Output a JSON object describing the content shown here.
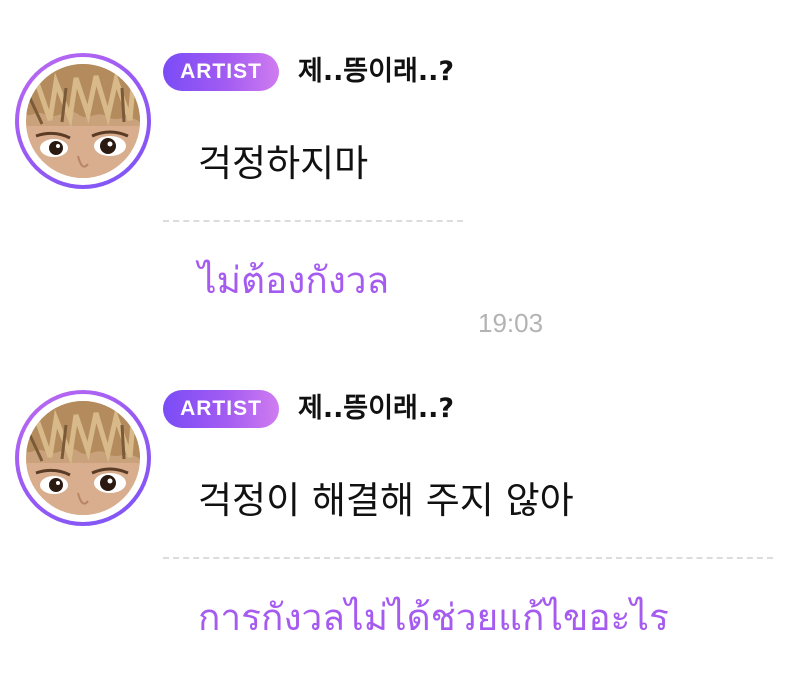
{
  "messages": [
    {
      "badge": "ARTIST",
      "sender": "제..뜽이래..?",
      "original_text": "걱정하지마",
      "translated_text": "ไม่ต้องกังวล",
      "timestamp": "19:03"
    },
    {
      "badge": "ARTIST",
      "sender": "제..뜽이래..?",
      "original_text": "걱정이 해결해 주지 않아",
      "translated_text": "การกังวลไม่ได้ช่วยแก้ไขอะไร"
    }
  ],
  "colors": {
    "badge_gradient_start": "#7a4cf6",
    "badge_gradient_end": "#d07cf0",
    "translation_text": "#a65bf0",
    "timestamp_text": "#b3b3b3",
    "avatar_ring": "#9a5af4",
    "divider": "#dcdcdc"
  },
  "icons": {
    "avatar": "artist-profile-photo"
  }
}
